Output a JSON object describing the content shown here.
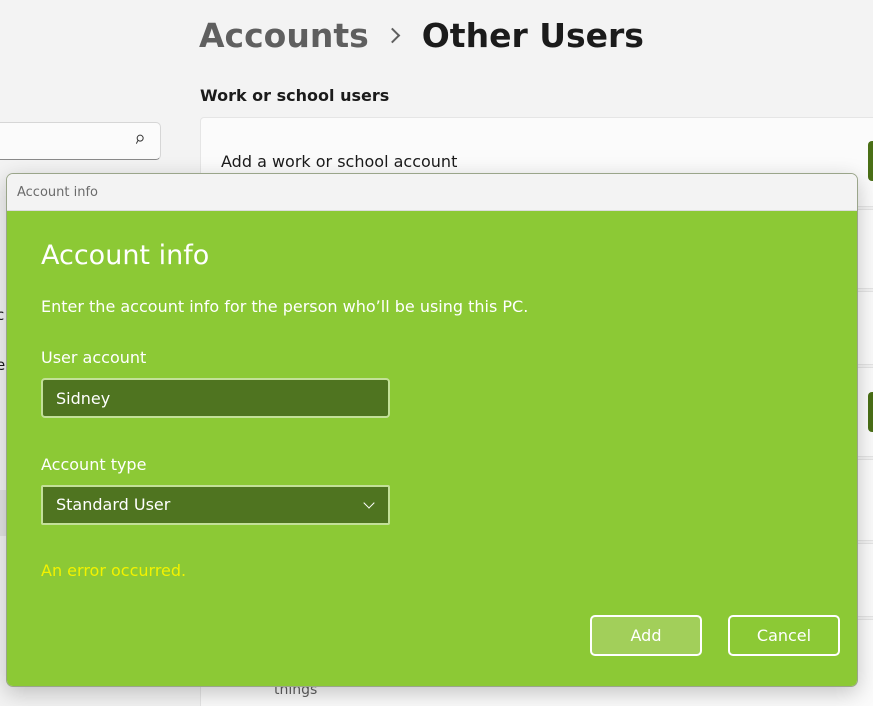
{
  "breadcrumb": {
    "parent": "Accounts",
    "current": "Other Users"
  },
  "section": {
    "heading": "Work or school users"
  },
  "cards": {
    "add_work_account": "Add a work or school account"
  },
  "background_fragments": {
    "side_c": "c",
    "side_e": "e",
    "things": "things"
  },
  "icons": {
    "search": "search-icon",
    "separator": "chevron-right-icon",
    "dropdown": "chevron-down-icon"
  },
  "dialog": {
    "window_title": "Account info",
    "heading": "Account info",
    "description": "Enter the account info for the person who’ll be using this PC.",
    "user_account_label": "User account",
    "user_account_value": "Sidney",
    "account_type_label": "Account type",
    "account_type_value": "Standard User",
    "error_message": "An error occurred.",
    "add_label": "Add",
    "cancel_label": "Cancel"
  },
  "colors": {
    "dialog_accent": "#8cc935",
    "input_fill": "#4f7420",
    "error": "#f2f200",
    "app_button": "#4a6f16"
  }
}
